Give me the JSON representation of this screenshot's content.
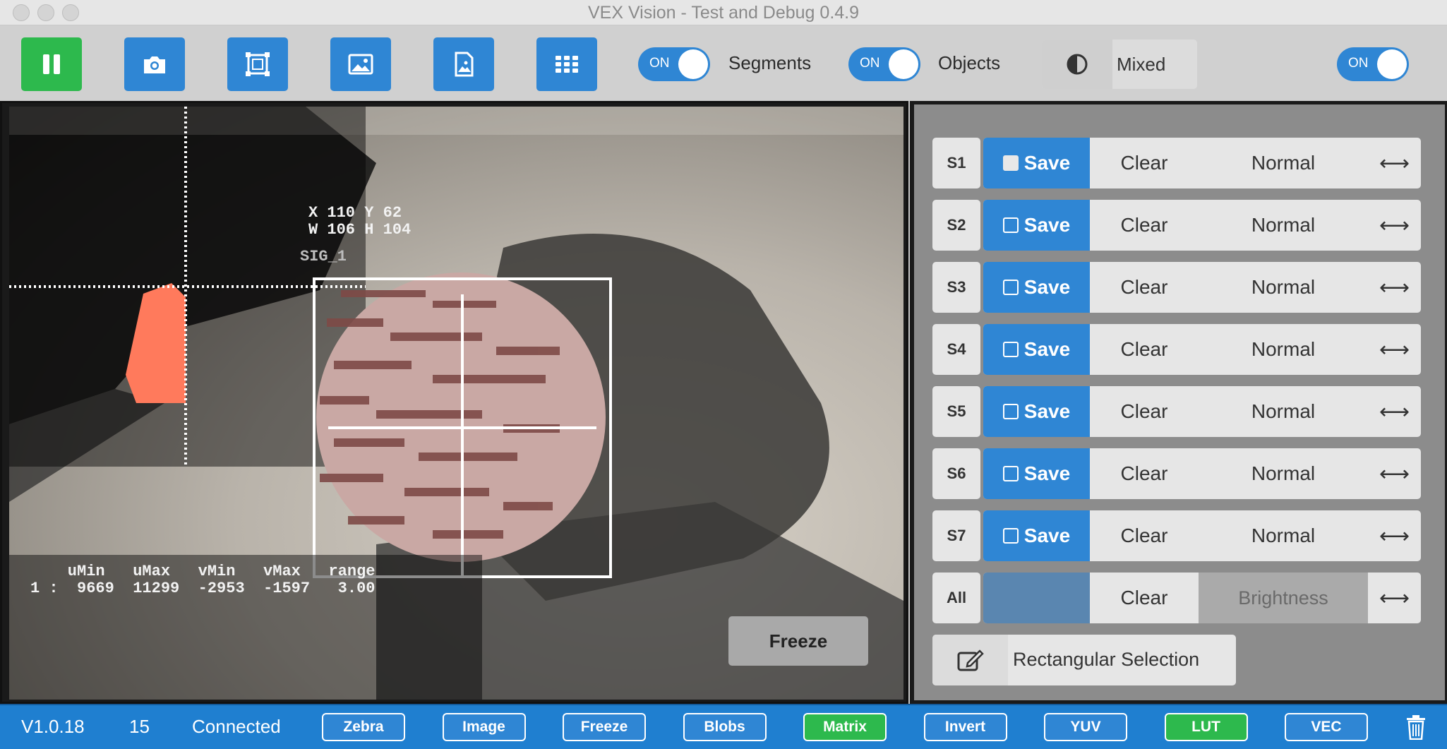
{
  "window": {
    "title": "VEX Vision - Test and Debug 0.4.9"
  },
  "toolbar": {
    "segments_toggle": "ON",
    "segments_label": "Segments",
    "objects_toggle": "ON",
    "objects_label": "Objects",
    "mode_label": "Mixed",
    "right_toggle": "ON"
  },
  "video": {
    "coords_line1": "X 110 Y 62",
    "coords_line2": "W 106 H 104",
    "signature_label": "SIG_1",
    "stats_header": "    uMin   uMax   vMin   vMax   range",
    "stats_row": "1 :  9669  11299  -2953  -1597   3.00",
    "freeze_label": "Freeze",
    "colors": {
      "blob_highlight": "#ff7a5c",
      "box_outline": "#ffffff"
    }
  },
  "signatures": [
    {
      "id": "S1",
      "save": "Save",
      "clear": "Clear",
      "mode": "Normal",
      "arrow": "⟷",
      "checked": true
    },
    {
      "id": "S2",
      "save": "Save",
      "clear": "Clear",
      "mode": "Normal",
      "arrow": "⟷",
      "checked": false
    },
    {
      "id": "S3",
      "save": "Save",
      "clear": "Clear",
      "mode": "Normal",
      "arrow": "⟷",
      "checked": false
    },
    {
      "id": "S4",
      "save": "Save",
      "clear": "Clear",
      "mode": "Normal",
      "arrow": "⟷",
      "checked": false
    },
    {
      "id": "S5",
      "save": "Save",
      "clear": "Clear",
      "mode": "Normal",
      "arrow": "⟷",
      "checked": false
    },
    {
      "id": "S6",
      "save": "Save",
      "clear": "Clear",
      "mode": "Normal",
      "arrow": "⟷",
      "checked": false
    },
    {
      "id": "S7",
      "save": "Save",
      "clear": "Clear",
      "mode": "Normal",
      "arrow": "⟷",
      "checked": false
    }
  ],
  "all_row": {
    "id": "All",
    "clear": "Clear",
    "brightness": "Brightness",
    "arrow": "⟷"
  },
  "rect_selection": {
    "label": "Rectangular Selection"
  },
  "statusbar": {
    "version": "V1.0.18",
    "fps": "15",
    "status": "Connected",
    "buttons": [
      {
        "label": "Zebra",
        "on": false
      },
      {
        "label": "Image",
        "on": false
      },
      {
        "label": "Freeze",
        "on": false
      },
      {
        "label": "Blobs",
        "on": false
      },
      {
        "label": "Matrix",
        "on": true
      },
      {
        "label": "Invert",
        "on": false
      },
      {
        "label": "YUV",
        "on": false
      },
      {
        "label": "LUT",
        "on": true
      },
      {
        "label": "VEC",
        "on": false
      }
    ],
    "colors": {
      "bar": "#1f7fd0",
      "active": "#2db94d"
    }
  },
  "icons": [
    "pause-icon",
    "camera-icon",
    "select-region-icon",
    "image-icon",
    "image-file-icon",
    "grid-icon",
    "contrast-icon",
    "edit-icon",
    "trash-icon"
  ]
}
